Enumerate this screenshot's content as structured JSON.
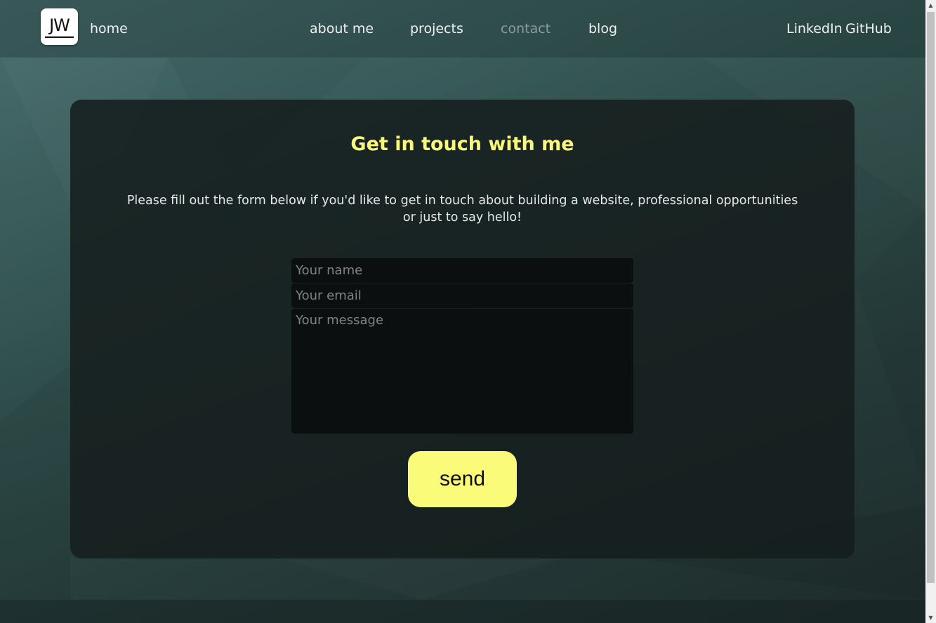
{
  "logo": {
    "text": "JW"
  },
  "nav": {
    "home": "home",
    "about": "about me",
    "projects": "projects",
    "contact": "contact",
    "blog": "blog",
    "linkedin": "LinkedIn",
    "github": "GitHub",
    "active": "contact"
  },
  "contact": {
    "title": "Get in touch with me",
    "intro": "Please fill out the form below if you'd like to get in touch about building a website, professional opportunities or just to say hello!",
    "name_placeholder": "Your name",
    "email_placeholder": "Your email",
    "message_placeholder": "Your message",
    "send_label": "send"
  },
  "colors": {
    "accent": "#fbfb7a",
    "title": "#f9f87a",
    "card": "#161e1e",
    "field": "#0b0f0f"
  }
}
